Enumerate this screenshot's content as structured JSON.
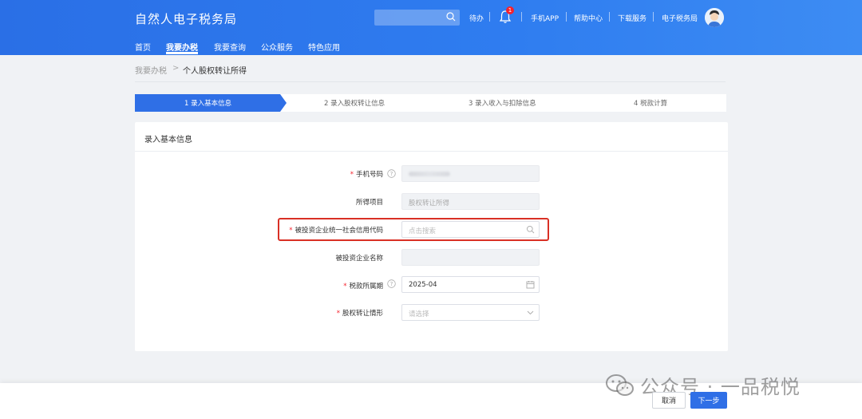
{
  "header": {
    "brand": "自然人电子税务局",
    "search_placeholder": "",
    "todo": "待办",
    "notification_count": "1",
    "links": [
      "手机APP",
      "帮助中心",
      "下载服务",
      "电子税务局"
    ],
    "nav": [
      "首页",
      "我要办税",
      "我要查询",
      "公众服务",
      "特色应用"
    ],
    "active_nav": "我要办税"
  },
  "breadcrumb": {
    "parent": "我要办税",
    "separator": ">",
    "current": "个人股权转让所得"
  },
  "steps": [
    {
      "label": "1  录入基本信息",
      "active": true
    },
    {
      "label": "2  录入股权转让信息",
      "active": false
    },
    {
      "label": "3  录入收入与扣除信息",
      "active": false
    },
    {
      "label": "4  税款计算",
      "active": false
    }
  ],
  "form": {
    "title": "录入基本信息",
    "fields": [
      {
        "label": "手机号码",
        "required": true,
        "help": true,
        "value": "",
        "placeholder": "",
        "type": "disabled"
      },
      {
        "label": "所得项目",
        "required": false,
        "help": false,
        "value": "股权转让所得",
        "type": "disabled"
      },
      {
        "label": "被投资企业统一社会信用代码",
        "required": true,
        "help": false,
        "value": "",
        "placeholder": "点击搜索",
        "type": "search"
      },
      {
        "label": "被投资企业名称",
        "required": false,
        "help": false,
        "value": "",
        "type": "disabled"
      },
      {
        "label": "税款所属期",
        "required": true,
        "help": true,
        "value": "2025-04",
        "type": "date"
      },
      {
        "label": "股权转让情形",
        "required": true,
        "help": false,
        "value": "",
        "placeholder": "请选择",
        "type": "select"
      }
    ]
  },
  "footer": {
    "cancel": "取消",
    "next": "下一步"
  },
  "watermark": "公众号 · 一品税悦",
  "colors": {
    "primary": "#2f6fe6",
    "highlight": "#d93025",
    "required": "#f5222d"
  }
}
